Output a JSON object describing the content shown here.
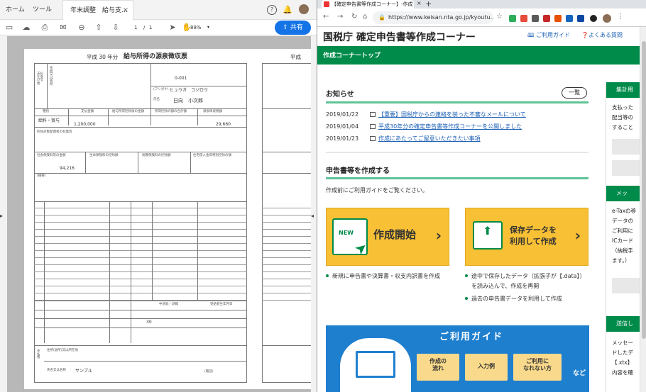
{
  "pdf_app": {
    "tabs": {
      "home": "ホーム",
      "tools": "ツール",
      "document": "年末調整　給与支..."
    },
    "toolbar": {
      "page_current": "1",
      "page_separator": "/",
      "page_total": "1",
      "zoom": "88%",
      "share_label": "共有"
    },
    "document": {
      "year_label": "平成 30 年分",
      "title": "給与所得の源泉徴収票",
      "page2_year": "平成",
      "recipient_label": "支払を受ける者",
      "address_label": "住所又は居所",
      "id_number": "0-001",
      "furigana_label": "(フリガナ)",
      "furigana": "ヒュウガ　コジロウ",
      "name_label": "氏名",
      "name": "日向　小次郎",
      "col_type": "種別",
      "col_payment": "支払金額",
      "col_after_deduction": "給与所得控除後の金額",
      "col_deduction_total": "所得控除の額の合計額",
      "col_tax": "源泉徴収税額",
      "type_value": "給料・賞与",
      "payment_value": "1,200,000",
      "tax_value": "29,660",
      "spouse_label": "控除対象配偶者の有無等",
      "insurance_social": "社会保険料等の金額",
      "insurance_life": "生命保険料の控除額",
      "insurance_earthquake": "地震保険料の控除額",
      "housing_loan": "住宅借入金等特別控除の額",
      "insurance_value": "94,216",
      "remarks_label": "(摘要)",
      "payer_label": "支払者",
      "payer_address": "住所(居所)又は所在地",
      "payer_name": "氏名又は名称",
      "payer_name_value": "サンプル",
      "phone_label": "(電話)",
      "mid_year_label": "中途就・退職",
      "birth_label": "受給者生年月日",
      "birth_day": "30"
    }
  },
  "browser": {
    "tab_title": "【確定申告書等作成コーナー】-作成",
    "new_tab": "+",
    "url": "https://www.keisan.nta.go.jp/kyoutu..."
  },
  "site": {
    "title": "国税庁 確定申告書等作成コーナー",
    "header_links": {
      "guide": "ご利用ガイド",
      "faq": "よくある質問"
    },
    "section_bar": "作成コーナートップ",
    "notices_title": "お知らせ",
    "notices_more": "一覧",
    "notices": [
      {
        "date": "2019/01/22",
        "text": "【重要】国税庁からの連絡を装った不審なメールについて"
      },
      {
        "date": "2019/01/04",
        "text": "平成30年分の確定申告書等作成コーナーを公開しました"
      },
      {
        "date": "2019/01/23",
        "text": "作成にあたってご留意いただきたい事項"
      }
    ],
    "create_title": "申告書等を作成する",
    "create_sub": "作成前にご利用ガイドをご覧ください。",
    "start_button": {
      "badge": "NEW",
      "label": "作成開始"
    },
    "saved_button": {
      "label_line1": "保存データを",
      "label_line2": "利用して作成"
    },
    "start_bullets": [
      "新規に申告書や決算書・収支内訳書を作成"
    ],
    "saved_bullets": [
      "途中で保存したデータ（拡張子が【.data】）",
      "を読み込んで、作成を再開",
      "過去の申告書データを利用して作成"
    ],
    "guide_banner": {
      "title": "ご利用ガイド",
      "buttons": [
        {
          "line1": "作成の",
          "line2": "流れ"
        },
        {
          "line1": "入力例",
          "line2": ""
        },
        {
          "line1": "ご利用に",
          "line2": "なれない方"
        }
      ],
      "etc": "など"
    },
    "side": {
      "header1": "集計用",
      "text1": [
        "支払った",
        "配当等の",
        "すること"
      ],
      "header2": "メッ",
      "text2": [
        "e-Taxの移",
        "データの",
        "ご利用に",
        "ICカード",
        "（納税手",
        "ます。）"
      ],
      "header3": "送信し",
      "text3": [
        "メッセー",
        "ドしたデ",
        "【.xtx】",
        "内容を確"
      ]
    }
  },
  "colors": {
    "accent_green": "#008b4a",
    "yellow": "#f7c035",
    "guide_blue": "#1f7fcf",
    "share_blue": "#1473e6"
  }
}
